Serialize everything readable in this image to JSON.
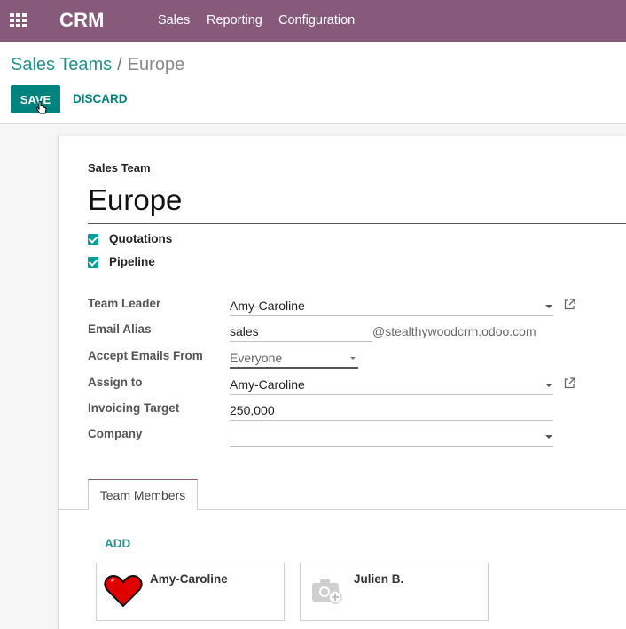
{
  "app": {
    "name": "CRM"
  },
  "menu": {
    "sales": "Sales",
    "reporting": "Reporting",
    "configuration": "Configuration"
  },
  "breadcrumb": {
    "parent": "Sales Teams",
    "separator": "/",
    "current": "Europe"
  },
  "buttons": {
    "save": "SAVE",
    "discard": "DISCARD"
  },
  "form": {
    "team_label": "Sales Team",
    "team_name": "Europe",
    "checkboxes": [
      {
        "label": "Quotations",
        "checked": true
      },
      {
        "label": "Pipeline",
        "checked": true
      }
    ],
    "fields": {
      "team_leader": {
        "label": "Team Leader",
        "value": "Amy-Caroline"
      },
      "email_alias": {
        "label": "Email Alias",
        "value": "sales",
        "domain": "@stealthywoodcrm.odoo.com"
      },
      "accept_emails": {
        "label": "Accept Emails From",
        "value": "Everyone"
      },
      "assign_to": {
        "label": "Assign to",
        "value": "Amy-Caroline"
      },
      "invoicing_target": {
        "label": "Invoicing Target",
        "value": "250,000"
      },
      "company": {
        "label": "Company",
        "value": ""
      }
    }
  },
  "tabs": [
    {
      "label": "Team Members",
      "active": true
    }
  ],
  "members": {
    "add_label": "ADD",
    "items": [
      {
        "name": "Amy-Caroline",
        "avatar": "heart-icon"
      },
      {
        "name": "Julien B.",
        "avatar": "camera-placeholder-icon"
      }
    ]
  },
  "colors": {
    "topbar": "#875a7b",
    "primary": "#00827f",
    "link": "#21928c",
    "checkbox": "#00a09d"
  }
}
